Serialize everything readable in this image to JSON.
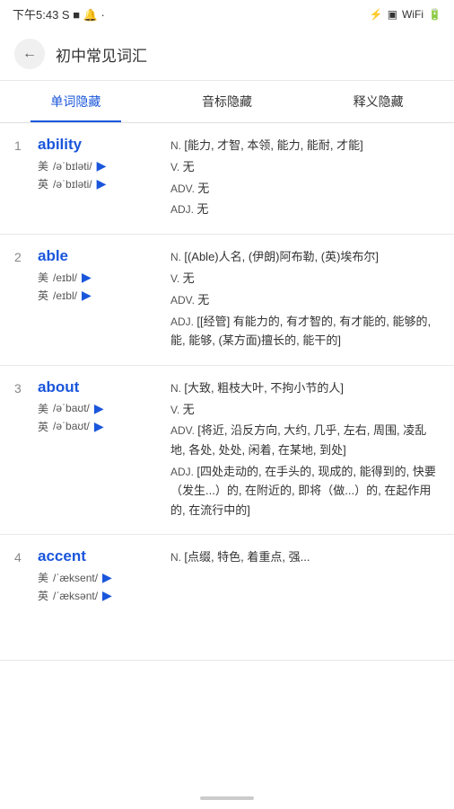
{
  "statusBar": {
    "time": "下午5:43",
    "icons": [
      "S",
      "■",
      "🔔",
      "·"
    ],
    "rightIcons": [
      "无线",
      "信号",
      "wifi",
      "电池"
    ]
  },
  "header": {
    "backLabel": "←",
    "title": "初中常见词汇"
  },
  "tabs": [
    {
      "id": "word",
      "label": "单词隐藏",
      "active": true
    },
    {
      "id": "phonetic",
      "label": "音标隐藏",
      "active": false
    },
    {
      "id": "meaning",
      "label": "释义隐藏",
      "active": false
    }
  ],
  "entries": [
    {
      "number": "1",
      "word": "ability",
      "phonetics": [
        {
          "region": "美",
          "ipa": "/əˈbɪləti/"
        },
        {
          "region": "英",
          "ipa": "/əˈbɪləti/"
        }
      ],
      "definitions": [
        {
          "pos": "N.",
          "text": "[能力, 才智, 本领, 能力, 能耐, 才能]"
        },
        {
          "pos": "V.",
          "text": "无"
        },
        {
          "pos": "ADV.",
          "text": "无"
        },
        {
          "pos": "ADJ.",
          "text": "无"
        }
      ]
    },
    {
      "number": "2",
      "word": "able",
      "phonetics": [
        {
          "region": "美",
          "ipa": "/eɪbl/"
        },
        {
          "region": "英",
          "ipa": "/eɪbl/"
        }
      ],
      "definitions": [
        {
          "pos": "N.",
          "text": "[(Able)人名, (伊朗)阿布勒, (英)埃布尔]"
        },
        {
          "pos": "V.",
          "text": "无"
        },
        {
          "pos": "ADV.",
          "text": "无"
        },
        {
          "pos": "ADJ.",
          "text": "[[经管] 有能力的, 有才智的, 有才能的, 能够的, 能, 能够, (某方面)擅长的, 能干的]"
        }
      ]
    },
    {
      "number": "3",
      "word": "about",
      "phonetics": [
        {
          "region": "美",
          "ipa": "/əˈbaʊt/"
        },
        {
          "region": "英",
          "ipa": "/əˈbaʊt/"
        }
      ],
      "definitions": [
        {
          "pos": "N.",
          "text": "[大致, 粗枝大叶, 不拘小节的人]"
        },
        {
          "pos": "V.",
          "text": "无"
        },
        {
          "pos": "ADV.",
          "text": "[将近, 沿反方向, 大约, 几乎, 左右, 周围, 凌乱地, 各处, 处处, 闲着, 在某地, 到处]"
        },
        {
          "pos": "ADJ.",
          "text": "[四处走动的, 在手头的, 现成的, 能得到的, 快要（发生...）的, 在附近的, 即将（做...）的, 在起作用的, 在流行中的]"
        }
      ]
    },
    {
      "number": "4",
      "word": "accent",
      "phonetics": [
        {
          "region": "美",
          "ipa": "/ˈæksent/"
        },
        {
          "region": "英",
          "ipa": "/ˈæksənt/"
        }
      ],
      "definitions": [
        {
          "pos": "N.",
          "text": "[点缀, 特色, 着重点, 强..."
        }
      ]
    }
  ]
}
